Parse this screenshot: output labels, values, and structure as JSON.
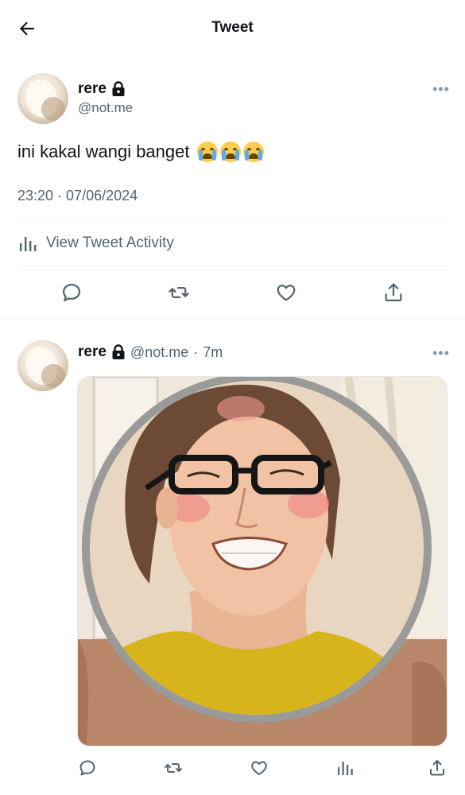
{
  "header": {
    "title": "Tweet"
  },
  "main_tweet": {
    "author_name": "rere",
    "author_handle": "@not.me",
    "text": "ini kakal wangi banget",
    "emoji_count": 3,
    "timestamp": "23:20 · 07/06/2024",
    "activity_label": "View Tweet Activity"
  },
  "reply_tweet": {
    "author_name": "rere",
    "author_handle": "@not.me",
    "separator": "·",
    "time": "7m"
  },
  "icons": {
    "back": "arrow-left-icon",
    "lock": "lock-icon",
    "more": "more-horizontal-icon",
    "reply": "reply-bubble-icon",
    "retweet": "retweet-icon",
    "like": "heart-icon",
    "share": "share-upload-icon",
    "analytics": "bar-chart-icon"
  },
  "colors": {
    "text": "#0f1419",
    "secondary": "#536471",
    "divider": "#eff3f4"
  }
}
